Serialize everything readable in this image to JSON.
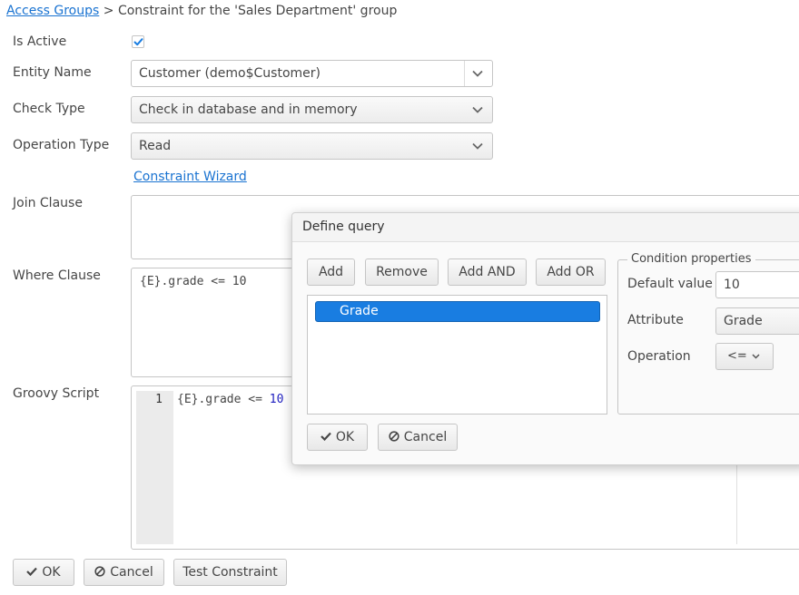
{
  "breadcrumb": {
    "link": "Access Groups",
    "separator": ">",
    "title": "Constraint for the 'Sales Department' group"
  },
  "form": {
    "is_active": {
      "label": "Is Active",
      "checked": true
    },
    "entity_name": {
      "label": "Entity Name",
      "value": "Customer (demo$Customer)"
    },
    "check_type": {
      "label": "Check Type",
      "value": "Check in database and in memory"
    },
    "operation_type": {
      "label": "Operation Type",
      "value": "Read"
    },
    "wizard_link": "Constraint Wizard",
    "join_clause": {
      "label": "Join Clause",
      "value": ""
    },
    "where_clause": {
      "label": "Where Clause",
      "value": "{E}.grade <= 10"
    },
    "groovy_script": {
      "label": "Groovy Script",
      "line_number": "1",
      "code_prefix": "{E}.grade <= ",
      "code_number": "10"
    }
  },
  "footer": {
    "ok": "OK",
    "cancel": "Cancel",
    "test": "Test Constraint"
  },
  "dialog": {
    "title": "Define query",
    "toolbar": {
      "add": "Add",
      "remove": "Remove",
      "add_and": "Add AND",
      "add_or": "Add OR"
    },
    "tree_items": [
      "Grade"
    ],
    "condition_properties": {
      "caption": "Condition properties",
      "default_value_label": "Default value",
      "default_value": "10",
      "attribute_label": "Attribute",
      "attribute_value": "Grade",
      "operation_label": "Operation",
      "operation_value": "<="
    },
    "ok": "OK",
    "cancel": "Cancel"
  },
  "colors": {
    "link": "#1a73d1",
    "selection": "#197de1",
    "code_number": "#1f1fbf"
  }
}
